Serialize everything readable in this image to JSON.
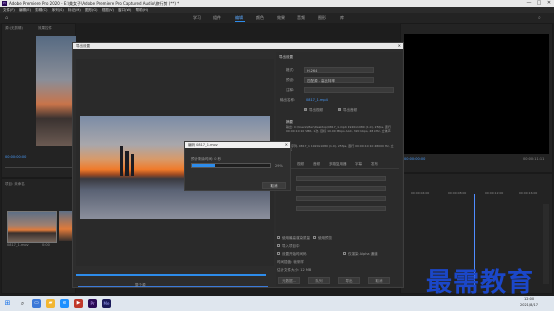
{
  "window": {
    "title": "Adobe Premiere Pro 2020 - E:\\美女子\\Adobe Premiere Pro Captured Audio\\旅行剪 (**) *",
    "minimize": "—",
    "maximize": "□",
    "close": "✕"
  },
  "menu": [
    "文件(F)",
    "编辑(E)",
    "剪辑(C)",
    "序列(S)",
    "标记(M)",
    "图形(G)",
    "视图(V)",
    "窗口(W)",
    "帮助(H)"
  ],
  "workspaces": [
    {
      "label": "学习",
      "active": false
    },
    {
      "label": "组件",
      "active": false
    },
    {
      "label": "编辑",
      "active": true
    },
    {
      "label": "颜色",
      "active": false
    },
    {
      "label": "效果",
      "active": false
    },
    {
      "label": "音频",
      "active": false
    },
    {
      "label": "图形",
      "active": false
    },
    {
      "label": "库",
      "active": false
    }
  ],
  "source_panel": {
    "tabs": [
      "源:(无剪辑)",
      "效果控件",
      "音频剪辑混合器"
    ],
    "timecode": "00:00:00:00"
  },
  "project_panel": {
    "title": "项目: 未命名",
    "clip_name": "0817_1.mov",
    "clip_duration": "0:00"
  },
  "program_monitor": {
    "timecode_left": "00:00:00:00",
    "timecode_right": "00:00:11:11"
  },
  "timeline": {
    "ruler": [
      "00:00:04:00",
      "00:00:08:00",
      "00:00:12:00",
      "00:00:16:00"
    ]
  },
  "export_dialog": {
    "title": "导出设置",
    "section_title": "导出设置",
    "labels": [
      "格式:",
      "预设:",
      "注释:",
      "输出名称:"
    ],
    "format_value": "H.264",
    "preset_value": "匹配源 - 高比特率",
    "output_name": "0817_1.mp4",
    "export_video_label": "导出视频",
    "export_audio_label": "导出音频",
    "summary_title": "摘要",
    "summary_output": "输出: C:\\Users\\Mac\\Desktop\\0817_1.mp4 1920x1080 (1.0), 25fps, 逐行 00:00:10:10 VBR, 1次, 目标 10.00 Mbps AAC, 320 kbps, 48 kHz, 立体声",
    "summary_source": "源: 序列, 0817_1 1920x1080 (1.0), 25fps, 逐行 00:00:10:10 48000 Hz, 立体声",
    "tabs": [
      "效果",
      "视频",
      "音频",
      "多路复用器",
      "字幕",
      "发布"
    ],
    "options": [
      "使用最高渲染质量",
      "使用预览",
      "导入项目中",
      "设置开始时间码",
      "仅渲染 Alpha 通道",
      "时间插值: 帧采样"
    ],
    "estimated_size": "估计文件大小: 12 MB",
    "buttons": {
      "metadata": "元数据...",
      "queue": "队列",
      "export": "导出",
      "cancel": "取消"
    },
    "source_range": "整个源"
  },
  "progress_dialog": {
    "title": "编码 0817_1.mov",
    "message": "预计剩余时间: 0 秒",
    "percent": "29%",
    "progress": 0.29,
    "cancel": "取消"
  },
  "taskbar": {
    "time": "12:00",
    "date": "2021/8/17"
  },
  "watermark": "最需教育",
  "colors": {
    "accent": "#2d8ceb",
    "watermark": "#1b47c9",
    "playhead": "#4f8cff"
  }
}
